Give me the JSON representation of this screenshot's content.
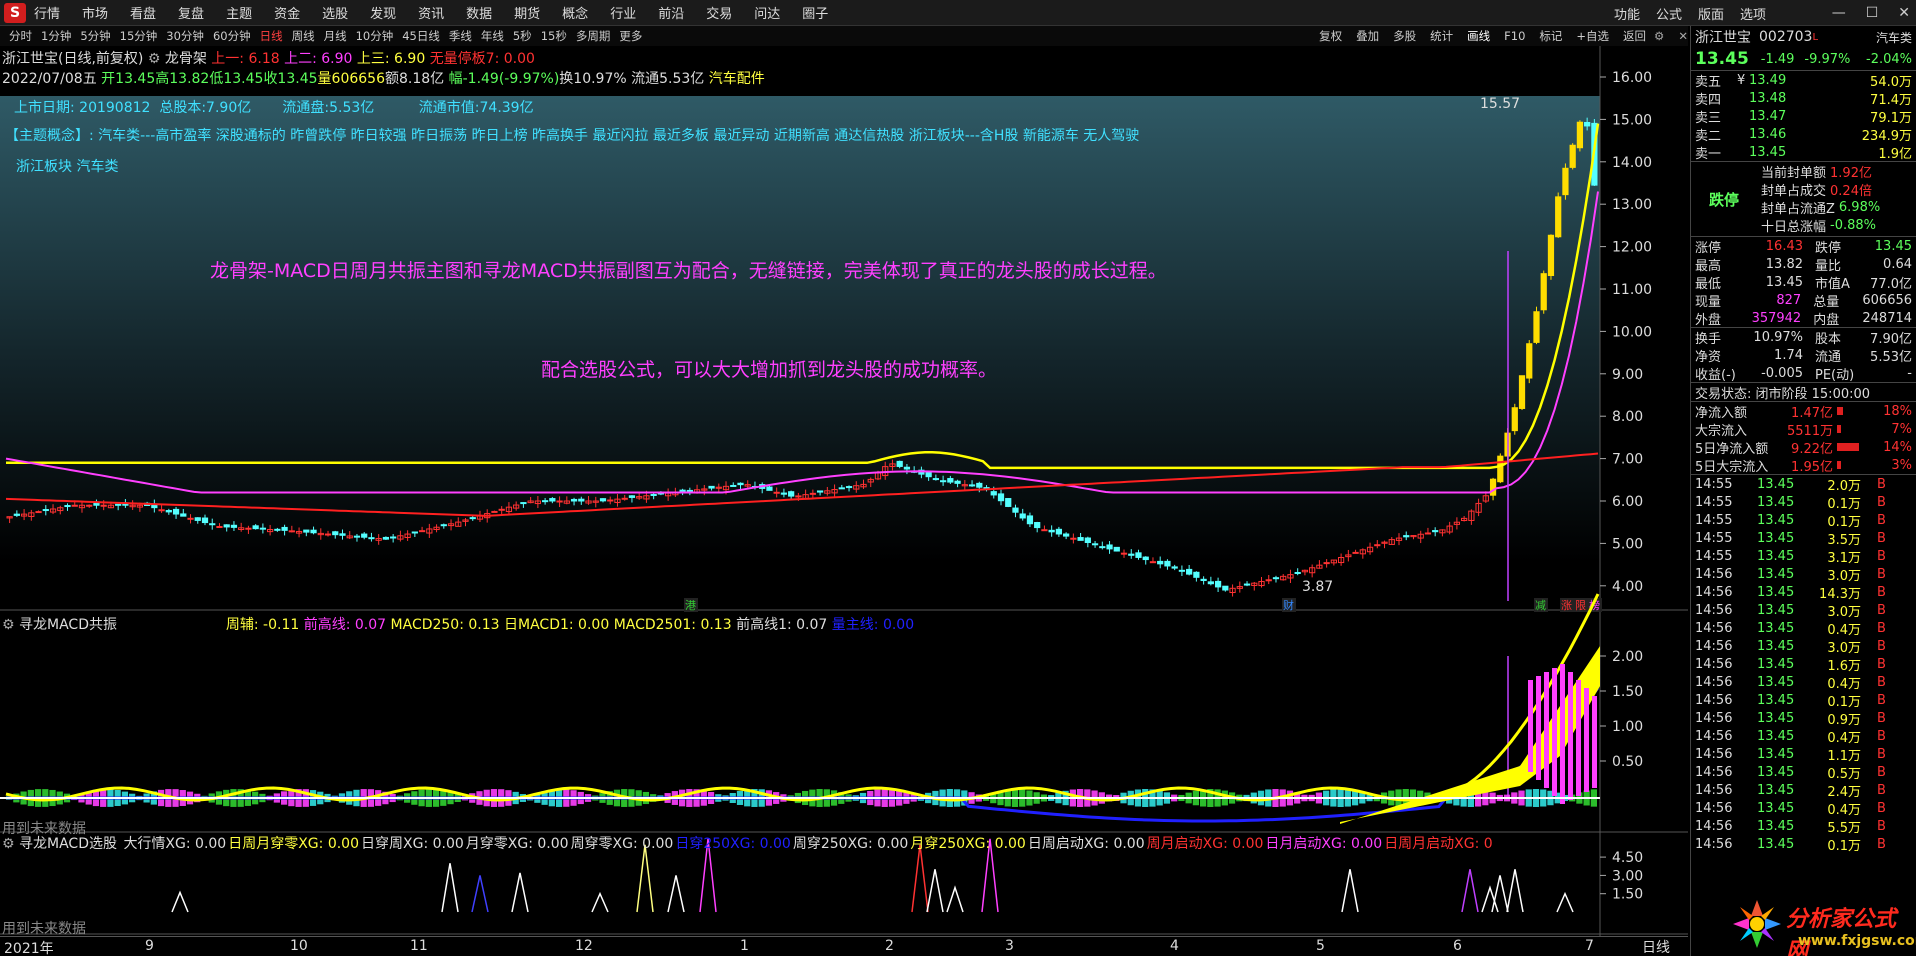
{
  "menu": {
    "items": [
      "行情",
      "市场",
      "看盘",
      "复盘",
      "主题",
      "资金",
      "选股",
      "发现",
      "资讯",
      "数据",
      "期货",
      "概念",
      "行业",
      "前沿",
      "交易",
      "问达",
      "圈子"
    ],
    "right": [
      "功能",
      "公式",
      "版面",
      "选项"
    ]
  },
  "periods": {
    "items": [
      "分时",
      "1分钟",
      "5分钟",
      "15分钟",
      "30分钟",
      "60分钟",
      "日线",
      "周线",
      "月线",
      "10分钟",
      "45日线",
      "季线",
      "年线",
      "5秒",
      "15秒",
      "多周期",
      "更多"
    ],
    "active": 6,
    "right": [
      "复权",
      "叠加",
      "多股",
      "统计",
      "画线",
      "F10",
      "标记",
      "+自选",
      "返回"
    ],
    "right_active": 4
  },
  "main": {
    "title": "浙江世宝(日线,前复权)",
    "indicator": "龙骨架",
    "l1": "上一: 6.18",
    "l2": "上二: 6.90",
    "l3": "上三: 6.90",
    "l4": "无量停板7: 0.00",
    "bar_date": "2022/07/08五",
    "open": "开13.45",
    "high": "高13.82",
    "low": "低13.45",
    "close": "收13.45",
    "vol": "量606656",
    "amt": "额8.18亿",
    "chg": "幅-1.49(-9.97%)",
    "turn": "换10.97% 流通5.53亿",
    "sector": "汽车配件",
    "list_date": "上市日期: 20190812",
    "total_cap": "总股本:7.90亿",
    "float_cap": "流通盘:5.53亿",
    "float_val": "流通市值:74.39亿",
    "concept": "【主题概念】: 汽车类---高市盈率 深股通标的 昨曾跌停 昨日较强 昨日振荡 昨日上榜 昨高换手 最近闪拉 最近多板 最近异动 近期新高 通达信热股 浙江板块---含H股 新能源车 无人驾驶",
    "concept2": "浙江板块 汽车类",
    "note1": "龙骨架-MACD日周月共振主图和寻龙MACD共振副图互为配合，无缝链接，完美体现了真正的龙头股的成长过程。",
    "note2": "配合选股公式，可以大大增加抓到龙头股的成功概率。",
    "high_label": "15.57",
    "low_label": "3.87",
    "marks": [
      "港",
      "财",
      "减",
      "涨",
      "限",
      "榜"
    ],
    "yticks": [
      "16.00",
      "15.00",
      "14.00",
      "13.00",
      "12.00",
      "11.00",
      "10.00",
      "9.00",
      "8.00",
      "7.00",
      "6.00",
      "5.00",
      "4.00"
    ]
  },
  "sub1": {
    "name": "寻龙MACD共振",
    "a": "周辅: -0.11",
    "b": "前高线: 0.07",
    "c": "MACD250: 0.13",
    "d": "日MACD1: 0.00",
    "e": "MACD2501: 0.13",
    "f": "前高线1: 0.07",
    "g": "量主线: 0.00",
    "future": "用到未来数据",
    "yticks": [
      "2.00",
      "1.50",
      "1.00",
      "0.50"
    ]
  },
  "sub2": {
    "name": "寻龙MACD选股",
    "items": [
      "大行情XG: 0.00",
      "日周月穿零XG: 0.00",
      "日穿周XG: 0.00",
      "月穿零XG: 0.00",
      "周穿零XG: 0.00",
      "日穿250XG: 0.00",
      "周穿250XG: 0.00",
      "月穿250XG: 0.00",
      "日周启动XG: 0.00",
      "周月启动XG: 0.00",
      "日月启动XG: 0.00",
      "日周月启动XG: 0"
    ],
    "future": "用到未来数据",
    "yticks": [
      "4.50",
      "3.00",
      "1.50"
    ]
  },
  "xaxis": {
    "labels": [
      "2021年",
      "9",
      "10",
      "11",
      "12",
      "1",
      "2",
      "3",
      "4",
      "5",
      "6",
      "7"
    ],
    "period": "日线"
  },
  "quote": {
    "name": "浙江世宝",
    "code": "002703",
    "sector": "汽车类",
    "price": "13.45",
    "chg": "-1.49",
    "pct": "-9.97%",
    "sector_pct": "-2.04%",
    "asks": [
      [
        "卖五",
        "¥",
        "13.49",
        "54.0万"
      ],
      [
        "卖四",
        "",
        "13.48",
        "71.4万"
      ],
      [
        "卖三",
        "",
        "13.47",
        "79.1万"
      ],
      [
        "卖二",
        "",
        "13.46",
        "234.9万"
      ],
      [
        "卖一",
        "",
        "13.45",
        "1.9亿"
      ]
    ],
    "limit_label": "跌停",
    "limit_rows": [
      [
        "当前封单额",
        "1.92亿"
      ],
      [
        "封单占成交",
        "0.24倍"
      ],
      [
        "封单占流通Z",
        "6.98%"
      ],
      [
        "十日总涨幅",
        "-0.88%"
      ]
    ],
    "stats": [
      [
        "涨停",
        "16.43",
        "跌停",
        "13.45"
      ],
      [
        "最高",
        "13.82",
        "量比",
        "0.64"
      ],
      [
        "最低",
        "13.45",
        "市值A",
        "77.0亿"
      ],
      [
        "现量",
        "827",
        "总量",
        "606656"
      ],
      [
        "外盘",
        "357942",
        "内盘",
        "248714"
      ]
    ],
    "stats2": [
      [
        "换手",
        "10.97%",
        "股本",
        "7.90亿"
      ],
      [
        "净资",
        "1.74",
        "流通",
        "5.53亿"
      ],
      [
        "收益(-)",
        "-0.005",
        "PE(动)",
        "-"
      ]
    ],
    "status": "交易状态: 闭市阶段 15:00:00",
    "flows": [
      [
        "净流入额",
        "1.47亿",
        "18%"
      ],
      [
        "大宗流入",
        "5511万",
        "7%"
      ],
      [
        "5日净流入额",
        "9.22亿",
        "14%"
      ],
      [
        "5日大宗流入",
        "1.95亿",
        "3%"
      ]
    ],
    "ticks": [
      [
        "14:55",
        "13.45",
        "2.0万",
        "B"
      ],
      [
        "14:55",
        "13.45",
        "0.1万",
        "B"
      ],
      [
        "14:55",
        "13.45",
        "0.1万",
        "B"
      ],
      [
        "14:55",
        "13.45",
        "3.5万",
        "B"
      ],
      [
        "14:55",
        "13.45",
        "3.1万",
        "B"
      ],
      [
        "14:56",
        "13.45",
        "3.0万",
        "B"
      ],
      [
        "14:56",
        "13.45",
        "14.3万",
        "B"
      ],
      [
        "14:56",
        "13.45",
        "3.0万",
        "B"
      ],
      [
        "14:56",
        "13.45",
        "0.4万",
        "B"
      ],
      [
        "14:56",
        "13.45",
        "3.0万",
        "B"
      ],
      [
        "14:56",
        "13.45",
        "1.6万",
        "B"
      ],
      [
        "14:56",
        "13.45",
        "0.4万",
        "B"
      ],
      [
        "14:56",
        "13.45",
        "0.1万",
        "B"
      ],
      [
        "14:56",
        "13.45",
        "0.9万",
        "B"
      ],
      [
        "14:56",
        "13.45",
        "0.4万",
        "B"
      ],
      [
        "14:56",
        "13.45",
        "1.1万",
        "B"
      ],
      [
        "14:56",
        "13.45",
        "0.5万",
        "B"
      ],
      [
        "14:56",
        "13.45",
        "2.4万",
        "B"
      ],
      [
        "14:56",
        "13.45",
        "0.4万",
        "B"
      ],
      [
        "14:56",
        "13.45",
        "5.5万",
        "B"
      ],
      [
        "14:56",
        "13.45",
        "0.1万",
        "B"
      ]
    ]
  },
  "watermark": {
    "title": "分析家公式网",
    "url": "www.fxjgsw.com"
  },
  "colors": {
    "up": "#ff3232",
    "down": "#54ffff",
    "yellow": "#ffff00",
    "magenta": "#ff40ff",
    "red": "#ff2020",
    "bg_grad_top": "#2a5360"
  }
}
